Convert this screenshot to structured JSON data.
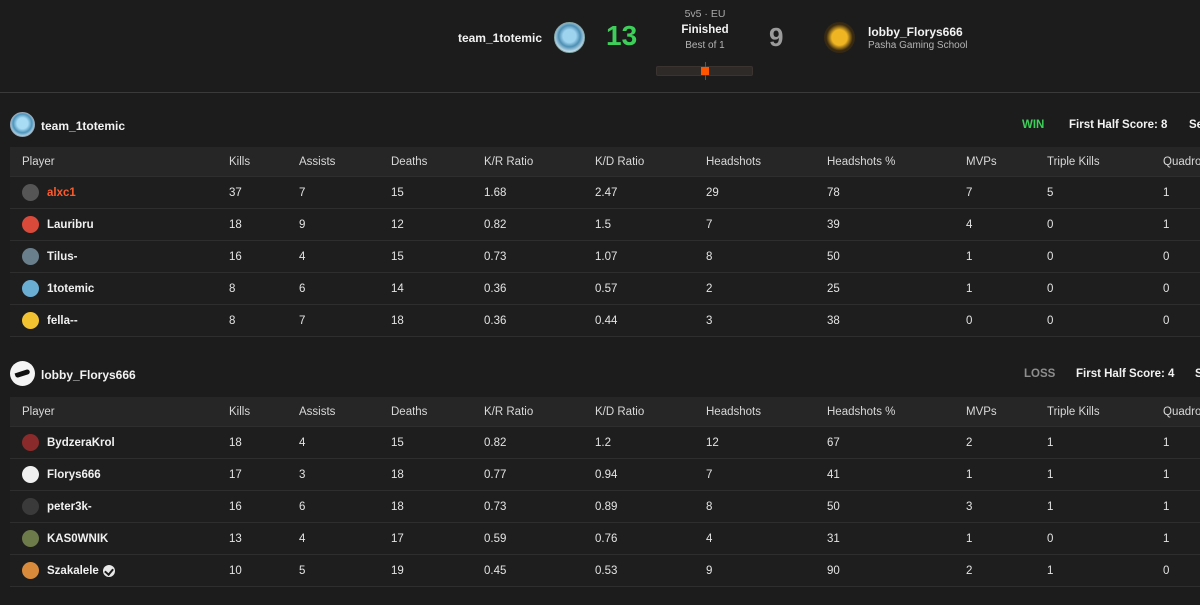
{
  "match": {
    "team1_name": "team_1totemic",
    "team1_score": "13",
    "team2_score": "9",
    "team2_name": "lobby_Florys666",
    "team2_subtitle": "Pasha Gaming School",
    "mode": "5v5 · EU",
    "status": "Finished",
    "best_of": "Best of 1"
  },
  "columns": [
    "Player",
    "Kills",
    "Assists",
    "Deaths",
    "K/R Ratio",
    "K/D Ratio",
    "Headshots",
    "Headshots %",
    "MVPs",
    "Triple Kills",
    "Quadro"
  ],
  "teams": [
    {
      "name": "team_1totemic",
      "result": "WIN",
      "first_half": "First Half Score: 8",
      "second_half_cut": "Se",
      "players": [
        {
          "name": "alxc1",
          "avatar_color": "#555555",
          "stats": [
            "37",
            "7",
            "15",
            "1.68",
            "2.47",
            "29",
            "78",
            "7",
            "5",
            "1"
          ]
        },
        {
          "name": "Lauribru",
          "avatar_color": "#d94a3a",
          "stats": [
            "18",
            "9",
            "12",
            "0.82",
            "1.5",
            "7",
            "39",
            "4",
            "0",
            "1"
          ]
        },
        {
          "name": "Tilus-",
          "avatar_color": "#6a7f8c",
          "stats": [
            "16",
            "4",
            "15",
            "0.73",
            "1.07",
            "8",
            "50",
            "1",
            "0",
            "0"
          ]
        },
        {
          "name": "1totemic",
          "avatar_color": "#6aaed4",
          "stats": [
            "8",
            "6",
            "14",
            "0.36",
            "0.57",
            "2",
            "25",
            "1",
            "0",
            "0"
          ]
        },
        {
          "name": "fella--",
          "avatar_color": "#f2c230",
          "stats": [
            "8",
            "7",
            "18",
            "0.36",
            "0.44",
            "3",
            "38",
            "0",
            "0",
            "0"
          ]
        }
      ]
    },
    {
      "name": "lobby_Florys666",
      "result": "LOSS",
      "first_half": "First Half Score: 4",
      "second_half_cut": "S",
      "players": [
        {
          "name": "BydzeraKrol",
          "avatar_color": "#8a2a2a",
          "stats": [
            "18",
            "4",
            "15",
            "0.82",
            "1.2",
            "12",
            "67",
            "2",
            "1",
            "1"
          ]
        },
        {
          "name": "Florys666",
          "avatar_color": "#f0f0f0",
          "stats": [
            "17",
            "3",
            "18",
            "0.77",
            "0.94",
            "7",
            "41",
            "1",
            "1",
            "1"
          ]
        },
        {
          "name": "peter3k-",
          "avatar_color": "#3a3a3a",
          "stats": [
            "16",
            "6",
            "18",
            "0.73",
            "0.89",
            "8",
            "50",
            "3",
            "1",
            "1"
          ]
        },
        {
          "name": "KAS0WNIK",
          "avatar_color": "#6d7a4a",
          "stats": [
            "13",
            "4",
            "17",
            "0.59",
            "0.76",
            "4",
            "31",
            "1",
            "0",
            "1"
          ]
        },
        {
          "name": "Szakalele",
          "avatar_color": "#d98a3a",
          "verified": true,
          "stats": [
            "10",
            "5",
            "19",
            "0.45",
            "0.53",
            "9",
            "90",
            "2",
            "1",
            "0"
          ]
        }
      ]
    }
  ],
  "colors": {
    "win": "#3ecf5a",
    "loss": "#8e8e8e",
    "accent": "#ff5500",
    "highlight_player": "#ff5a2a"
  }
}
